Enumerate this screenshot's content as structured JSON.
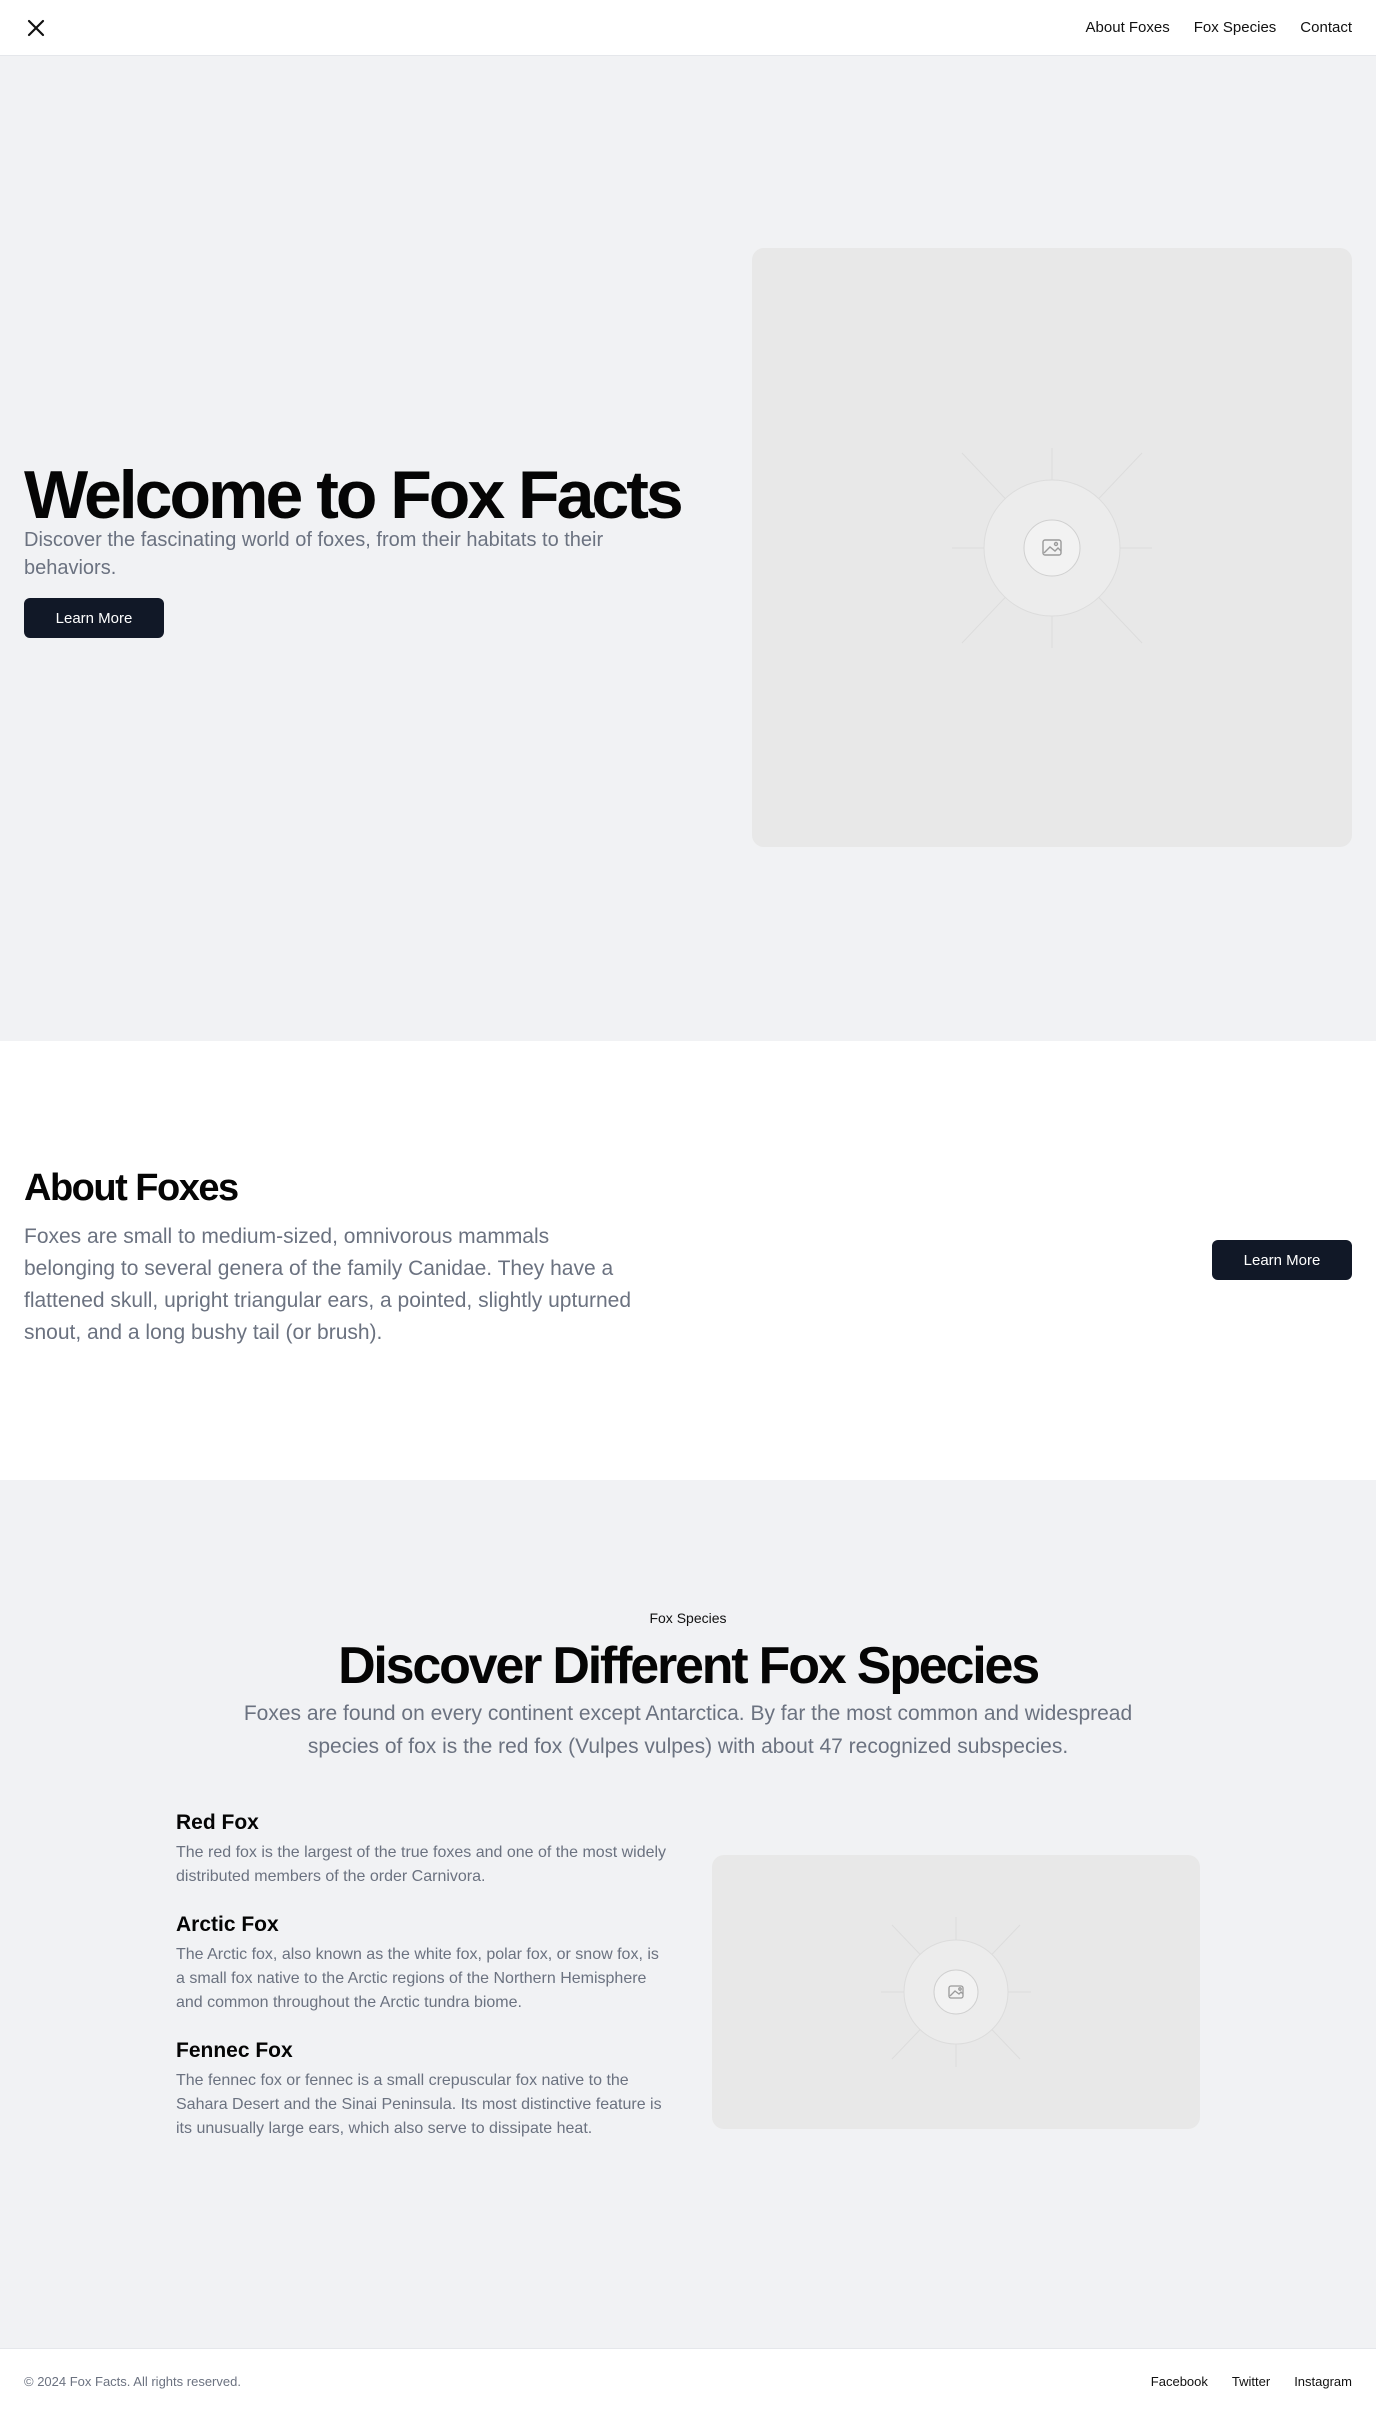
{
  "header": {
    "logo_icon": "close-x-icon",
    "nav": [
      "About Foxes",
      "Fox Species",
      "Contact"
    ]
  },
  "hero": {
    "title": "Welcome to Fox Facts",
    "subtitle": "Discover the fascinating world of foxes, from their habitats to their behaviors.",
    "button_label": "Learn More",
    "image_icon": "image-placeholder-icon"
  },
  "about": {
    "title": "About Foxes",
    "text": "Foxes are small to medium-sized, omnivorous mammals belonging to several genera of the family Canidae. They have a flattened skull, upright triangular ears, a pointed, slightly upturned snout, and a long bushy tail (or brush).",
    "button_label": "Learn More"
  },
  "species": {
    "eyebrow": "Fox Species",
    "title": "Discover Different Fox Species",
    "text": "Foxes are found on every continent except Antarctica. By far the most common and widespread species of fox is the red fox (Vulpes vulpes) with about 47 recognized subspecies.",
    "items": [
      {
        "name": "Red Fox",
        "description": "The red fox is the largest of the true foxes and one of the most widely distributed members of the order Carnivora."
      },
      {
        "name": "Arctic Fox",
        "description": "The Arctic fox, also known as the white fox, polar fox, or snow fox, is a small fox native to the Arctic regions of the Northern Hemisphere and common throughout the Arctic tundra biome."
      },
      {
        "name": "Fennec Fox",
        "description": "The fennec fox or fennec is a small crepuscular fox native to the Sahara Desert and the Sinai Peninsula. Its most distinctive feature is its unusually large ears, which also serve to dissipate heat."
      }
    ],
    "image_icon": "image-placeholder-icon"
  },
  "footer": {
    "copyright": "© 2024 Fox Facts. All rights reserved.",
    "links": [
      "Facebook",
      "Twitter",
      "Instagram"
    ]
  },
  "colors": {
    "accent": "#111827",
    "section_bg": "#f1f2f4",
    "muted_text": "#6b7280"
  }
}
